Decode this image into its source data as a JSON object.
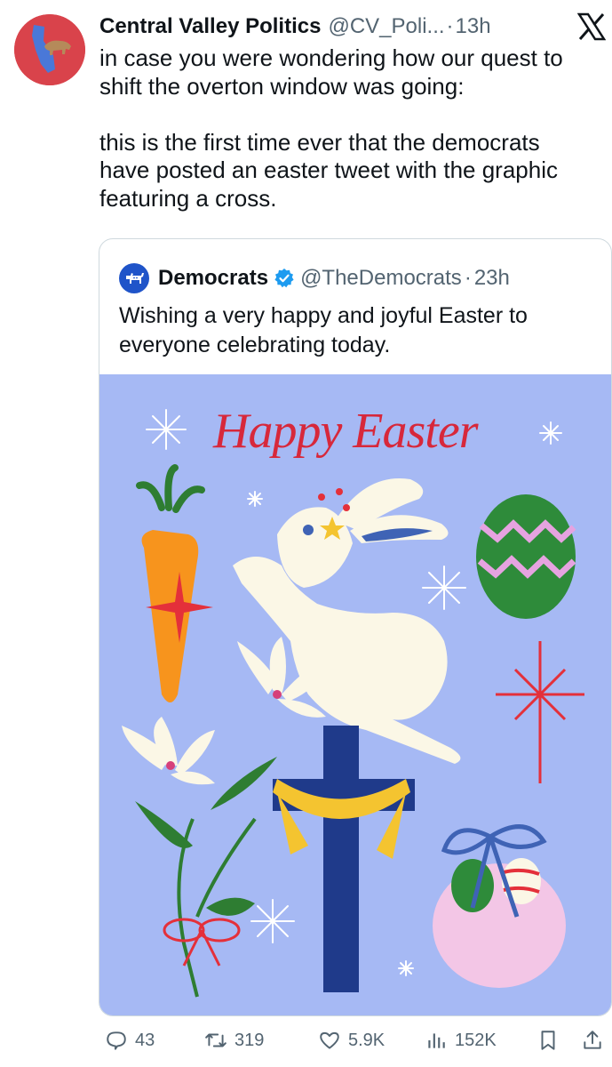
{
  "tweet": {
    "author_name": "Central Valley Politics",
    "author_handle": "@CV_Poli...",
    "separator": "·",
    "time": "13h",
    "text_lines": [
      "in case you were wondering how our quest to",
      "shift the overton window was going:",
      "",
      "this is the first time ever that the democrats",
      "have posted an easter tweet with the graphic",
      "featuring a cross."
    ]
  },
  "quoted": {
    "author_name": "Democrats",
    "author_handle": "@TheDemocrats",
    "separator": "·",
    "time": "23h",
    "text_lines": [
      "Wishing a very happy and joyful Easter to",
      "everyone celebrating today."
    ],
    "image_title": "Happy Easter"
  },
  "actions": {
    "replies": "43",
    "reposts": "319",
    "likes": "5.9K",
    "views": "152K"
  },
  "icons": {
    "platform": "x-logo-icon",
    "reply": "reply-icon",
    "repost": "repost-icon",
    "like": "heart-icon",
    "views": "views-icon",
    "bookmark": "bookmark-icon",
    "share": "share-icon"
  },
  "colors": {
    "accent": "#1d9bf0",
    "muted": "#536471",
    "image_bg": "#a6b9f4",
    "title_red": "#d7283b"
  }
}
